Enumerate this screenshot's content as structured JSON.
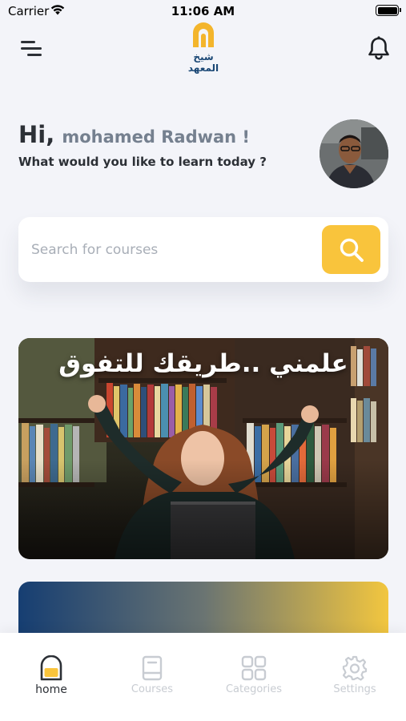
{
  "status_bar": {
    "carrier": "Carrier",
    "time": "11:06 AM"
  },
  "header": {
    "logo_text_line1": "شيخ",
    "logo_text_line2": "المعهد"
  },
  "greeting": {
    "hi": "Hi,",
    "name": "mohamed Radwan !",
    "subtitle": "What would you like to learn today ?"
  },
  "search": {
    "placeholder": "Search for courses",
    "value": ""
  },
  "banner": {
    "title": "علمني ..طريقك للتفوق"
  },
  "tabs": [
    {
      "label": "home",
      "icon": "home-icon",
      "active": true
    },
    {
      "label": "Courses",
      "icon": "book-icon",
      "active": false
    },
    {
      "label": "Categories",
      "icon": "grid-icon",
      "active": false
    },
    {
      "label": "Settings",
      "icon": "gear-icon",
      "active": false
    }
  ],
  "colors": {
    "accent": "#f9c43c",
    "brand_blue": "#1a4775",
    "background": "#f3f4f9",
    "text_dark": "#2c3036",
    "text_muted": "#75808f"
  }
}
